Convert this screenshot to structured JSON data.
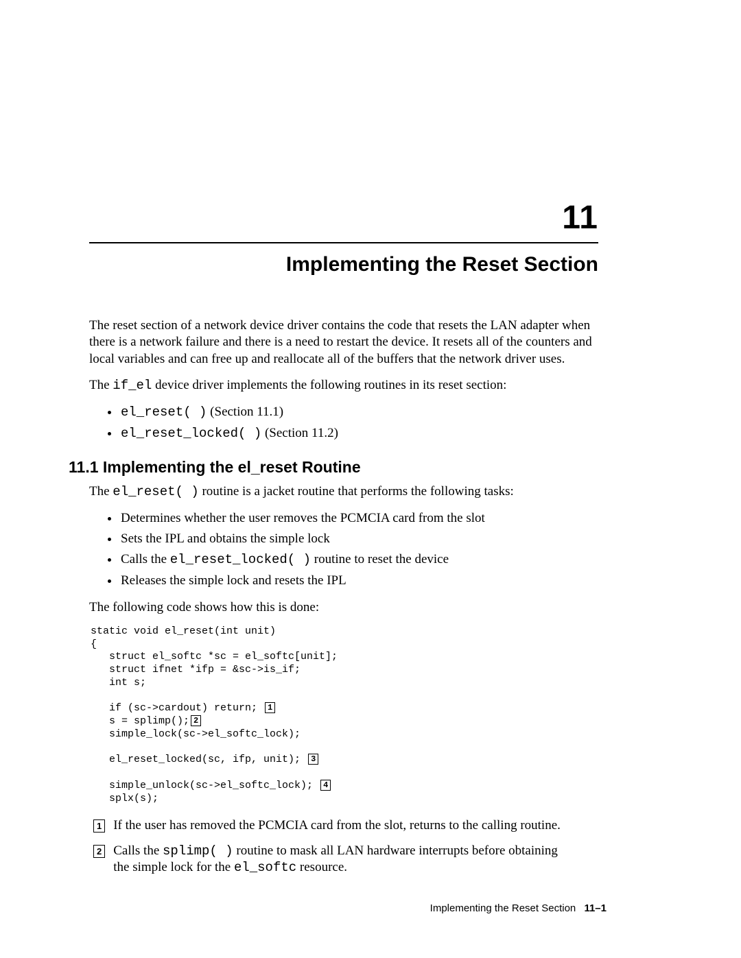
{
  "chapter": {
    "number": "11",
    "title": "Implementing the Reset Section"
  },
  "intro": {
    "p1": "The reset section of a network device driver contains the code that resets the LAN adapter when there is a network failure and there is a need to restart the device. It resets all of the counters and local variables and can free up and reallocate all of the buffers that the network driver uses.",
    "p2_pre": "The ",
    "p2_code": "if_el",
    "p2_post": " device driver implements the following routines in its reset section:",
    "bullets": [
      {
        "code": "el_reset( )",
        "suffix": " (Section 11.1)"
      },
      {
        "code": "el_reset_locked( )",
        "suffix": " (Section 11.2)"
      }
    ]
  },
  "section": {
    "heading": "11.1 Implementing the el_reset Routine",
    "p1_pre": "The ",
    "p1_code": "el_reset( )",
    "p1_post": " routine is a jacket routine that performs the following tasks:",
    "tasks": [
      "Determines whether the user removes the PCMCIA card from the slot",
      "Sets the IPL and obtains the simple lock"
    ],
    "task3_pre": "Calls the ",
    "task3_code": "el_reset_locked( )",
    "task3_post": " routine to reset the device",
    "task4": "Releases the simple lock and resets the IPL",
    "p2": "The following code shows how this is done:",
    "code": {
      "l1": "static void el_reset(int unit)",
      "l2": "{",
      "l3": "   struct el_softc *sc = el_softc[unit];",
      "l4": "   struct ifnet *ifp = &sc->is_if;",
      "l5": "   int s;",
      "blank1": "",
      "l6a": "   if (sc->cardout) return; ",
      "ref1": "1",
      "l7a": "   s = splimp();",
      "ref2": "2",
      "l8": "   simple_lock(sc->el_softc_lock);",
      "blank2": "",
      "l9a": "   el_reset_locked(sc, ifp, unit); ",
      "ref3": "3",
      "blank3": "",
      "l10a": "   simple_unlock(sc->el_softc_lock); ",
      "ref4": "4",
      "l11": "   splx(s);"
    },
    "callouts": [
      {
        "num": "1",
        "text_pre": "If the user has removed the PCMCIA card from the slot, returns to the calling routine.",
        "code": "",
        "text_post": ""
      },
      {
        "num": "2",
        "text_pre": "Calls the ",
        "code": "splimp( )",
        "text_mid": " routine to mask all LAN hardware interrupts before obtaining the simple lock for the ",
        "code2": "el_softc",
        "text_post": " resource."
      }
    ]
  },
  "footer": {
    "text": "Implementing the Reset Section",
    "page": "11–1"
  }
}
